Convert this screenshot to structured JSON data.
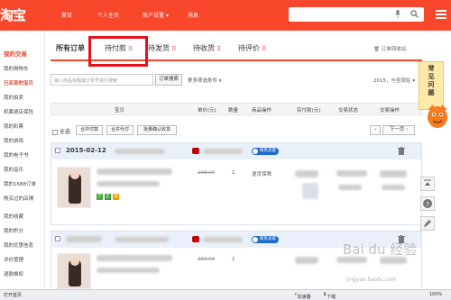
{
  "header": {
    "logo_text": "淘宝",
    "nav": [
      {
        "label": "首页"
      },
      {
        "label": "个人主页"
      },
      {
        "label": "账户设置 ▾"
      },
      {
        "label": "消息"
      }
    ]
  },
  "sidebar": {
    "heading": "我的交易",
    "items": [
      {
        "label": "我的购物车"
      },
      {
        "label": "已买到的宝贝"
      },
      {
        "label": "我的拍卖"
      },
      {
        "label": "机票酒店保险"
      },
      {
        "label": "我的彩票"
      },
      {
        "label": "我的游戏"
      },
      {
        "label": "我的电子书"
      },
      {
        "label": "我的音乐"
      },
      {
        "label": "我的1688订单"
      },
      {
        "label": "购买过的店铺"
      },
      {
        "label": "我的收藏"
      },
      {
        "label": "我的积分"
      },
      {
        "label": "我的优惠信息"
      },
      {
        "label": "评价管理"
      },
      {
        "label": "退款维权"
      }
    ]
  },
  "tabs": [
    {
      "label": "所有订单",
      "count": ""
    },
    {
      "label": "待付款",
      "count": "0"
    },
    {
      "label": "待发货",
      "count": "0"
    },
    {
      "label": "待收货",
      "count": "2"
    },
    {
      "label": "待评价",
      "count": "0"
    }
  ],
  "recycle_label": "订单回收站",
  "search": {
    "placeholder": "输入商品标题或订单号进行搜索",
    "button": "订单搜索",
    "more_filter": "更多筛选条件 ▾",
    "year_filter": "2015，与至现在 ▾"
  },
  "table_headers": [
    "宝贝",
    "单价(元)",
    "数量",
    "商品操作",
    "实付款(元)",
    "交易状态",
    "交易操作"
  ],
  "batch": {
    "select_all": "全选",
    "merge_pay": "合并付款",
    "merge_agent_pay": "合并代付",
    "batch_confirm": "批量确认收货",
    "next_page": "下一页"
  },
  "orders": [
    {
      "date": "2015-02-12",
      "price": "208.00",
      "qty": "1",
      "service": "退货保障",
      "seller_tag": "联系卖家"
    },
    {
      "date": "",
      "price": "269.00",
      "qty": "1",
      "service": "",
      "seller_tag": "联系卖家"
    }
  ],
  "faq": {
    "line1": "常",
    "line2": "见",
    "line3": "问",
    "line4": "题"
  },
  "statusbar": {
    "left": "打开首页",
    "accelerator": "加速器",
    "download": "下载",
    "zoom": "100%"
  },
  "watermark": {
    "logo": "Bai du 经验",
    "url": "jingyan.baidu.com"
  },
  "colors": {
    "brand": "#f8472a",
    "highlight_box": "#e3141c",
    "order_header": "#eaf0fa"
  }
}
